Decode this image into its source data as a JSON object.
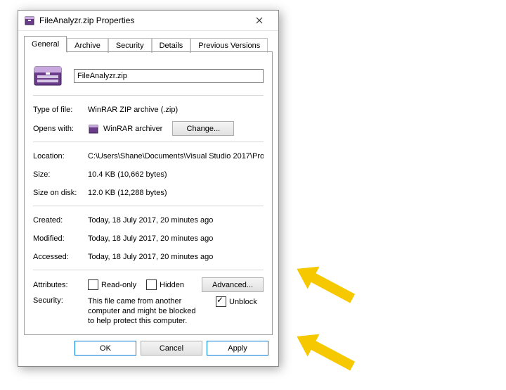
{
  "window": {
    "title": "FileAnalyzr.zip Properties"
  },
  "tabs": {
    "general": "General",
    "archive": "Archive",
    "security": "Security",
    "details": "Details",
    "previous": "Previous Versions"
  },
  "file": {
    "name": "FileAnalyzr.zip",
    "type_label": "Type of file:",
    "type_value": "WinRAR ZIP archive (.zip)",
    "opens_label": "Opens with:",
    "opens_value": "WinRAR archiver",
    "change_btn": "Change...",
    "location_label": "Location:",
    "location_value": "C:\\Users\\Shane\\Documents\\Visual Studio 2017\\Pro",
    "size_label": "Size:",
    "size_value": "10.4 KB (10,662 bytes)",
    "sizeondisk_label": "Size on disk:",
    "sizeondisk_value": "12.0 KB (12,288 bytes)",
    "created_label": "Created:",
    "created_value": "Today, 18 July 2017, 20 minutes ago",
    "modified_label": "Modified:",
    "modified_value": "Today, 18 July 2017, 20 minutes ago",
    "accessed_label": "Accessed:",
    "accessed_value": "Today, 18 July 2017, 20 minutes ago",
    "attributes_label": "Attributes:",
    "readonly_label": "Read-only",
    "hidden_label": "Hidden",
    "advanced_btn": "Advanced...",
    "security_label": "Security:",
    "security_note": "This file came from another computer and might be blocked to help protect this computer.",
    "unblock_label": "Unblock"
  },
  "buttons": {
    "ok": "OK",
    "cancel": "Cancel",
    "apply": "Apply"
  },
  "colors": {
    "accent": "#0078d7",
    "arrow": "#f5c800"
  }
}
